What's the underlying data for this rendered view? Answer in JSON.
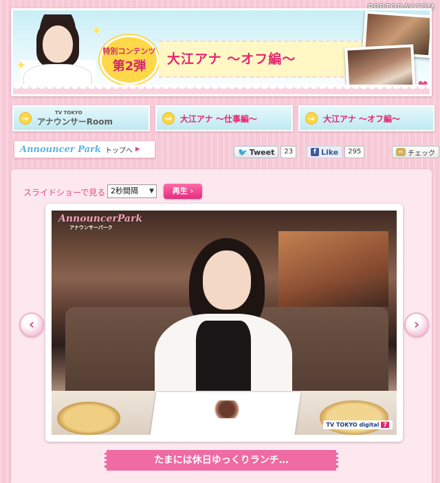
{
  "watermark": "RBBTODAY.COM",
  "banner": {
    "badge_line1": "特別コンテンツ",
    "badge_line2": "第2弾",
    "title": "大江アナ ～オフ編～"
  },
  "nav": [
    {
      "label": "アナウンサーRoom",
      "sub": "TV TOKYO"
    },
    {
      "label": "大江アナ ～仕事編～"
    },
    {
      "label": "大江アナ ～オフ編～"
    }
  ],
  "park_link": {
    "logo": "Announcer",
    "logo_accent": "Park",
    "text": "トップへ"
  },
  "social": {
    "tweet_label": "Tweet",
    "tweet_count": "23",
    "like_label": "Like",
    "like_count": "295",
    "check_label": "チェック"
  },
  "slideshow": {
    "label": "スライドショーで見る",
    "interval": "2秒間隔",
    "play_label": "再生"
  },
  "photo": {
    "logo": "Announcer",
    "logo_accent": "Park",
    "logo_sub": "アナウンサーパーク",
    "tv_logo": "TV TOKYO digital",
    "tv_channel": "7"
  },
  "caption": "たまには休日ゆっくりランチ…",
  "colors": {
    "accent_pink": "#e4266e",
    "background": "#f7c9d6",
    "nav_blue": "#bfe9f2"
  }
}
